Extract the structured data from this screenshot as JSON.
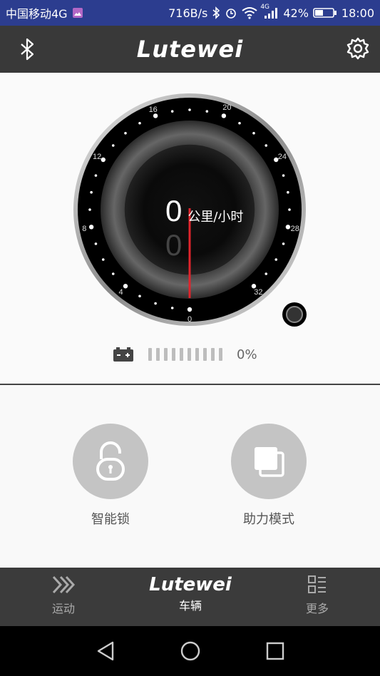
{
  "status_bar": {
    "carrier": "中国移动4G",
    "net_speed": "716B/s",
    "network_type": "4G",
    "battery": "42%",
    "time": "18:00"
  },
  "app_bar": {
    "logo": "Lutewei",
    "bluetooth_icon": "bluetooth-icon",
    "settings_icon": "gear-icon"
  },
  "speedometer": {
    "speed": "0",
    "unit": "公里/小时",
    "trip_reading": "0",
    "ticks": [
      "0",
      "4",
      "8",
      "12",
      "16",
      "20",
      "24",
      "28",
      "32"
    ]
  },
  "battery": {
    "percent": "0%",
    "segments": 10,
    "filled_segments": 0
  },
  "controls": {
    "smart_lock": "智能锁",
    "assist_mode": "助力模式"
  },
  "bottom_nav": {
    "sport": "运动",
    "vehicle_logo": "Lutewei",
    "vehicle": "车辆",
    "more": "更多"
  },
  "colors": {
    "status_bar_bg": "#2c3d8f",
    "app_bar_bg": "#393939",
    "needle": "#e0242c",
    "control_circle": "#c4c4c4"
  }
}
